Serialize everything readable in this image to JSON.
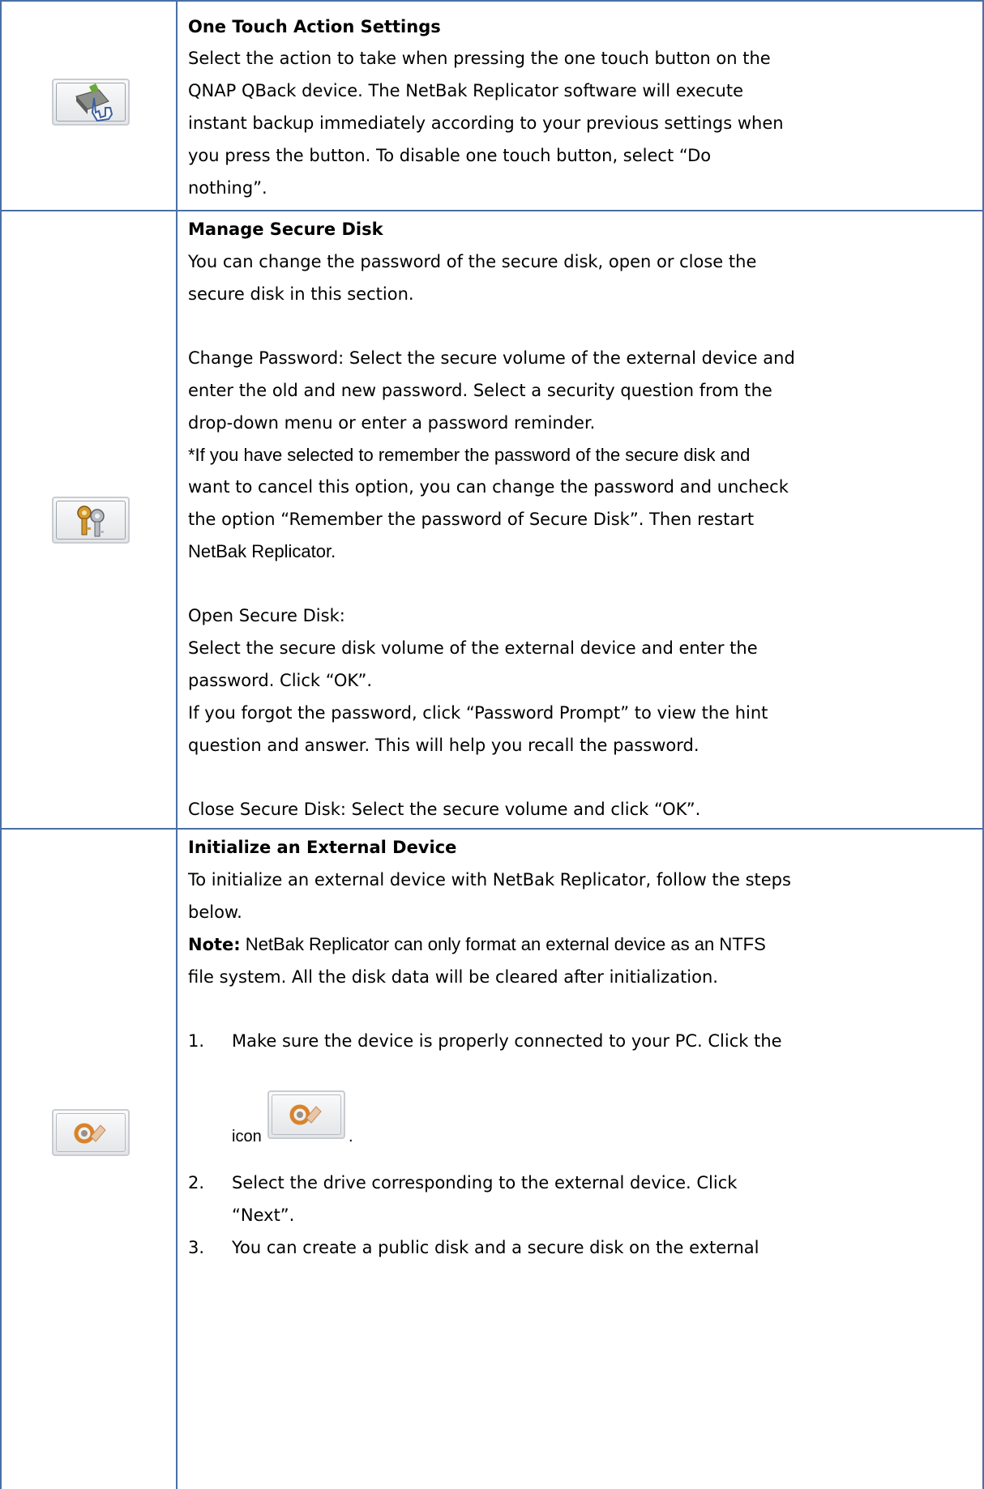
{
  "rows": [
    {
      "icon": "one-touch-hand-icon",
      "title": "One Touch Action Settings",
      "lines": [
        "Select the action to take when pressing the one touch button on the",
        "QNAP QBack device.   The NetBak Replicator software will execute",
        "instant backup immediately according to your previous settings when",
        "you press the button.   To disable one touch button, select “Do",
        "nothing”."
      ]
    },
    {
      "icon": "keys-icon",
      "title": "Manage Secure Disk",
      "p1": [
        "You can change the password of the secure disk, open or close the",
        "secure disk in this section."
      ],
      "p2": [
        "Change Password: Select the secure volume of the external device and",
        "enter the old and new password.   Select a security question from the",
        "drop-down menu or enter a password reminder."
      ],
      "p3": [
        "*If you have selected to remember the password of the secure disk and",
        "want to cancel this option, you can change the password and uncheck",
        "the option “Remember the password of Secure Disk”.   Then restart",
        "NetBak Replicator."
      ],
      "p4": [
        "Open Secure Disk:",
        "Select the secure disk volume of the external device and enter the",
        "password.   Click “OK”.",
        "If you forgot the password, click “Password Prompt” to view the hint",
        "question and answer.   This will help you recall the password."
      ],
      "p5": [
        "Close Secure Disk: Select the secure volume and click “OK”."
      ]
    },
    {
      "icon": "initialize-device-icon",
      "title": "Initialize an External Device",
      "intro": [
        "To initialize an external device with NetBak Replicator, follow the steps",
        "below."
      ],
      "note_label": "Note:",
      "note": [
        " NetBak Replicator can only format an external device as an NTFS",
        "file system. All the disk data will be cleared after initialization."
      ],
      "steps": [
        {
          "num": "1.",
          "lines": [
            "Make sure the device is properly connected to your PC.   Click the"
          ],
          "icon_prefix": "icon",
          "icon_suffix": "."
        },
        {
          "num": "2.",
          "lines": [
            "Select the drive corresponding to the external device.   Click",
            "“Next”."
          ]
        },
        {
          "num": "3.",
          "lines": [
            "You can create a public disk and a secure disk on the external"
          ]
        }
      ]
    }
  ]
}
